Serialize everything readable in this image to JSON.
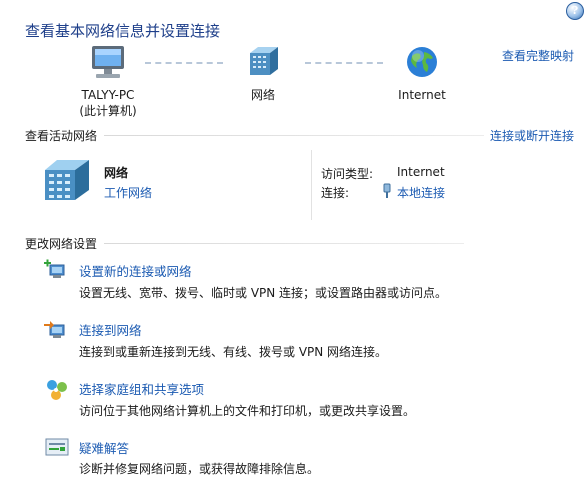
{
  "header": {
    "title": "查看基本网络信息并设置连接",
    "help": "?"
  },
  "map": {
    "full_map_link": "查看完整映射",
    "nodes": [
      {
        "label": "TALYY-PC",
        "sublabel": "(此计算机)"
      },
      {
        "label": "网络"
      },
      {
        "label": "Internet"
      }
    ]
  },
  "active": {
    "section_label": "查看活动网络",
    "connect_link": "连接或断开连接",
    "network_name": "网络",
    "network_type": "工作网络",
    "access_label": "访问类型:",
    "access_value": "Internet",
    "connection_label": "连接:",
    "connection_value": "本地连接"
  },
  "change": {
    "section_label": "更改网络设置",
    "tasks": [
      {
        "title": "设置新的连接或网络",
        "desc": "设置无线、宽带、拨号、临时或 VPN 连接；或设置路由器或访问点。"
      },
      {
        "title": "连接到网络",
        "desc": "连接到或重新连接到无线、有线、拨号或 VPN 网络连接。"
      },
      {
        "title": "选择家庭组和共享选项",
        "desc": "访问位于其他网络计算机上的文件和打印机，或更改共享设置。"
      },
      {
        "title": "疑难解答",
        "desc": "诊断并修复网络问题，或获得故障排除信息。"
      }
    ]
  }
}
